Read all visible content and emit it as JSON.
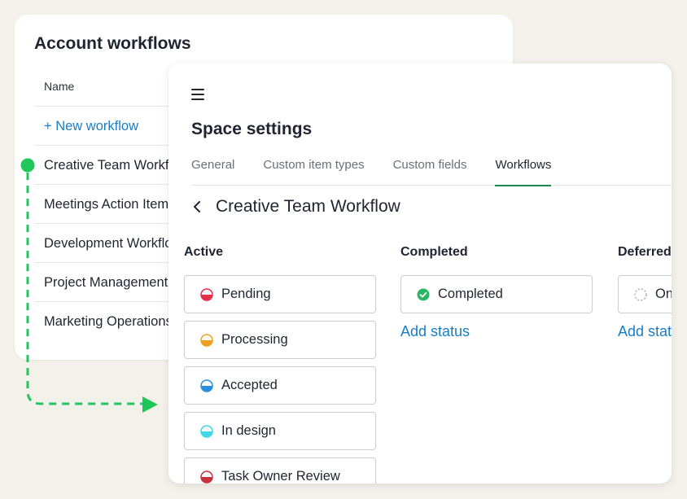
{
  "account_workflows": {
    "title": "Account workflows",
    "column_header": "Name",
    "new_workflow_label": "+ New workflow",
    "items": [
      "Creative Team Workflow",
      "Meetings Action Items",
      "Development Workflow",
      "Project Management",
      "Marketing Operations"
    ]
  },
  "space_settings": {
    "title": "Space settings",
    "tabs": [
      {
        "label": "General",
        "active": false
      },
      {
        "label": "Custom item types",
        "active": false
      },
      {
        "label": "Custom fields",
        "active": false
      },
      {
        "label": "Workflows",
        "active": true
      }
    ],
    "workflow_title": "Creative Team Workflow",
    "columns": {
      "active": {
        "title": "Active",
        "statuses": [
          {
            "label": "Pending",
            "color": "#e5304a",
            "icon": "half-circle-red-icon"
          },
          {
            "label": "Processing",
            "color": "#f0a020",
            "icon": "half-circle-orange-icon"
          },
          {
            "label": "Accepted",
            "color": "#2a8de0",
            "icon": "half-circle-blue-icon"
          },
          {
            "label": "In design",
            "color": "#3ed8e6",
            "icon": "half-circle-cyan-icon"
          },
          {
            "label": "Task Owner Review",
            "color": "#c8323f",
            "icon": "half-circle-crimson-icon"
          }
        ]
      },
      "completed": {
        "title": "Completed",
        "statuses": [
          {
            "label": "Completed",
            "color": "#2bb564",
            "icon": "check-circle-icon"
          }
        ],
        "add_status_label": "Add status"
      },
      "deferred": {
        "title": "Deferred",
        "statuses": [
          {
            "label": "On hold",
            "color": "#b5b8bd",
            "icon": "dashed-circle-icon"
          }
        ],
        "add_status_label": "Add status"
      }
    }
  },
  "colors": {
    "accent": "#1a7dc4",
    "tab_underline": "#1a8a4a",
    "connector": "#1fc75a"
  }
}
